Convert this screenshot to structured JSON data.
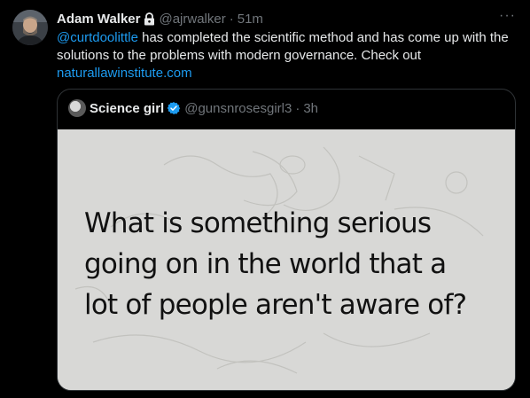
{
  "tweet": {
    "author": {
      "name": "Adam Walker",
      "handle": "@ajrwalker",
      "separator": "·",
      "time": "51m",
      "protected_icon": "lock-icon"
    },
    "more_icon": "more-horizontal-icon",
    "more_glyph": "···",
    "text": {
      "mention": "@curtdoolittle",
      "body": " has completed the scientific method and has come up with the solutions to the problems with modern governance. Check out ",
      "link": "naturallawinstitute.com"
    },
    "quote": {
      "author": {
        "name": "Science girl",
        "verified_icon": "verified-badge-icon",
        "handle": "@gunsnrosesgirl3",
        "separator": "·",
        "time": "3h"
      },
      "media_text_lines": [
        "What is something serious",
        "going on in the world that a",
        "lot of people aren't aware of?"
      ]
    }
  },
  "colors": {
    "background": "#000000",
    "text": "#e7e9ea",
    "muted": "#71767b",
    "link": "#1d9bf0",
    "border": "#2f3336",
    "meme_bg": "#d8d8d6"
  }
}
